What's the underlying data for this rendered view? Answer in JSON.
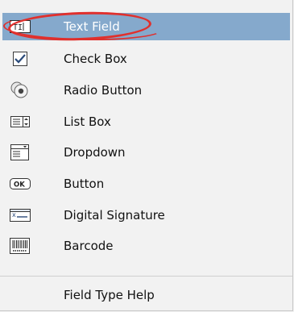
{
  "menu": {
    "items": [
      {
        "label": "Text Field",
        "icon": "text-field-icon",
        "highlighted": true
      },
      {
        "label": "Check Box",
        "icon": "checkbox-icon"
      },
      {
        "label": "Radio Button",
        "icon": "radio-button-icon"
      },
      {
        "label": "List Box",
        "icon": "list-box-icon"
      },
      {
        "label": "Dropdown",
        "icon": "dropdown-icon"
      },
      {
        "label": "Button",
        "icon": "ok-button-icon"
      },
      {
        "label": "Digital Signature",
        "icon": "digital-signature-icon"
      },
      {
        "label": "Barcode",
        "icon": "barcode-icon"
      }
    ],
    "help": {
      "label": "Field Type Help"
    }
  },
  "colors": {
    "highlight": "#85a9cc",
    "annotation": "#e0302d"
  }
}
